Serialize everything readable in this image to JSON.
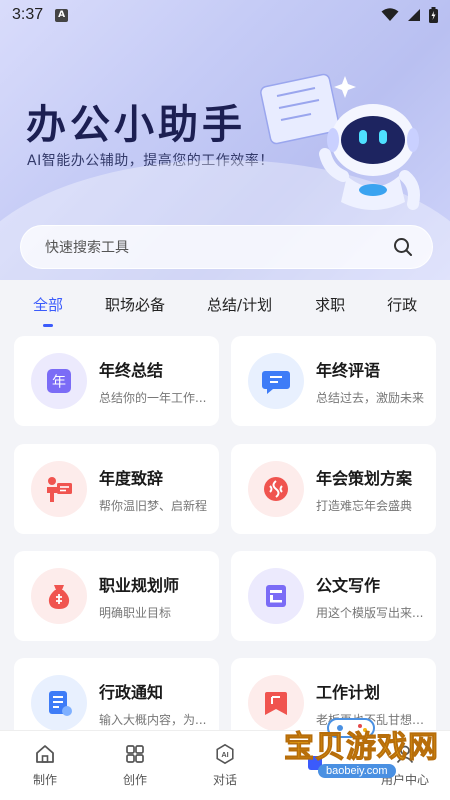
{
  "status_bar": {
    "time": "3:37",
    "notification_letter": "A"
  },
  "hero": {
    "title": "办公小助手",
    "subtitle": "AI智能办公辅助，提高您的工作效率！"
  },
  "search": {
    "placeholder": "快速搜索工具"
  },
  "tabs": [
    {
      "label": "全部",
      "active": true
    },
    {
      "label": "职场必备"
    },
    {
      "label": "总结/计划"
    },
    {
      "label": "求职"
    },
    {
      "label": "行政"
    }
  ],
  "tools": [
    {
      "title": "年终总结",
      "desc": "总结你的一年工作...",
      "icon": "year-calendar-icon",
      "icon_text": "年",
      "color": "#7b6cf6",
      "bg": "#eceafd"
    },
    {
      "title": "年终评语",
      "desc": "总结过去，激励未来",
      "icon": "comment-icon",
      "color": "#3e7cf7",
      "bg": "#e8f0fe"
    },
    {
      "title": "年度致辞",
      "desc": "帮你温旧梦、启新程",
      "icon": "speech-podium-icon",
      "color": "#f0544f",
      "bg": "#fdeceb"
    },
    {
      "title": "年会策划方案",
      "desc": "打造难忘年会盛典",
      "icon": "celebration-icon",
      "color": "#f0544f",
      "bg": "#fdeceb"
    },
    {
      "title": "职业规划师",
      "desc": "明确职业目标",
      "icon": "career-bag-icon",
      "color": "#f0544f",
      "bg": "#fdeceb"
    },
    {
      "title": "公文写作",
      "desc": "用这个模版写出来...",
      "icon": "document-icon",
      "color": "#7b6cf6",
      "bg": "#eceafd"
    },
    {
      "title": "行政通知",
      "desc": "输入大概内容，为...",
      "icon": "notice-icon",
      "color": "#3e7cf7",
      "bg": "#e8f0fe"
    },
    {
      "title": "工作计划",
      "desc": "老板再也不乱甘想看...",
      "icon": "bookmark-plan-icon",
      "color": "#f0544f",
      "bg": "#fdeceb"
    }
  ],
  "bottom_nav": [
    {
      "label": "制作",
      "icon": "home-icon"
    },
    {
      "label": "创作",
      "icon": "grid-icon"
    },
    {
      "label": "对话",
      "icon": "ai-chat-icon",
      "icon_text": "AI"
    },
    {
      "label": "",
      "icon": "tool-icon"
    },
    {
      "label": "用户中心",
      "icon": "user-icon"
    }
  ],
  "watermark": {
    "text": "宝贝游戏网",
    "url": "baobeiy.com"
  }
}
